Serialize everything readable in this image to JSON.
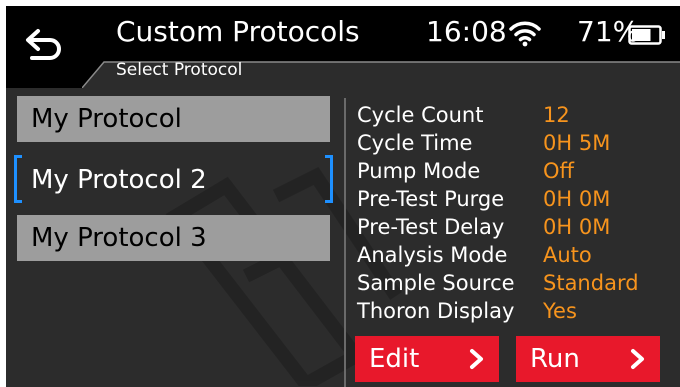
{
  "header": {
    "title": "Custom Protocols",
    "subtitle": "Select Protocol",
    "clock": "16:08",
    "battery_percent": "71%",
    "battery_level": 0.71,
    "icons": {
      "back": "back-arrow-icon",
      "wifi": "wifi-icon",
      "battery": "battery-icon"
    }
  },
  "protocols": [
    {
      "label": "My Protocol",
      "selected": false
    },
    {
      "label": "My Protocol 2",
      "selected": true
    },
    {
      "label": "My Protocol 3",
      "selected": false
    }
  ],
  "details": [
    {
      "label": "Cycle Count",
      "value": "12"
    },
    {
      "label": "Cycle Time",
      "value": "0H 5M"
    },
    {
      "label": "Pump Mode",
      "value": "Off"
    },
    {
      "label": "Pre-Test Purge",
      "value": "0H 0M"
    },
    {
      "label": "Pre-Test Delay",
      "value": "0H 0M"
    },
    {
      "label": "Analysis Mode",
      "value": "Auto"
    },
    {
      "label": "Sample Source",
      "value": "Standard"
    },
    {
      "label": "Thoron Display",
      "value": "Yes"
    }
  ],
  "actions": {
    "edit_label": "Edit",
    "run_label": "Run",
    "chevron_icon": "chevron-right-icon"
  },
  "colors": {
    "accent_value": "#f7941d",
    "button_red": "#e8182b",
    "selection_bracket": "#1e90ff",
    "list_item_bg": "#9d9d9d",
    "screen_bg": "#2c2c2c",
    "header_bg": "#000000"
  }
}
